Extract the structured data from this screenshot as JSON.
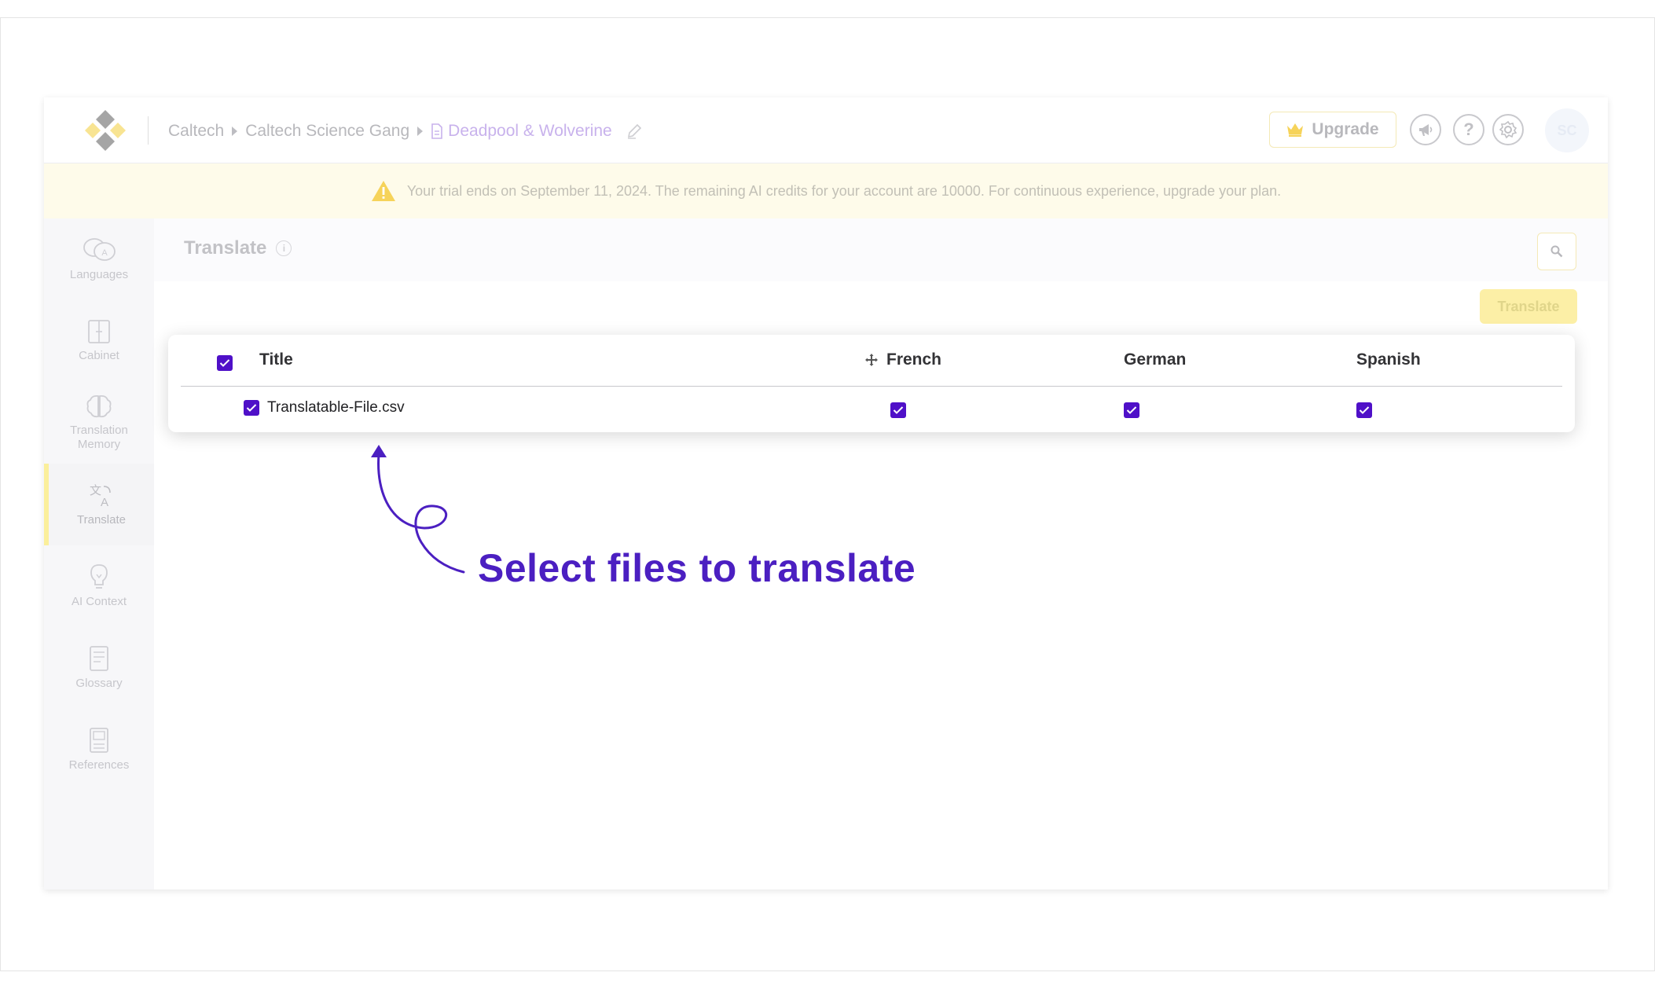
{
  "breadcrumb": {
    "org": "Caltech",
    "team": "Caltech Science Gang",
    "project": "Deadpool & Wolverine"
  },
  "header": {
    "upgrade_label": "Upgrade",
    "help_glyph": "?",
    "avatar_initials": "SC"
  },
  "banner": {
    "text": "Your trial ends on September 11, 2024. The remaining AI credits for your account are 10000. For continuous experience, upgrade your plan."
  },
  "sidebar": {
    "items": [
      {
        "label": "Languages",
        "icon": "languages-icon"
      },
      {
        "label": "Cabinet",
        "icon": "cabinet-icon"
      },
      {
        "label": "Translation Memory",
        "icon": "brain-icon"
      },
      {
        "label": "Translate",
        "icon": "translate-icon",
        "active": true
      },
      {
        "label": "AI Context",
        "icon": "lightbulb-icon"
      },
      {
        "label": "Glossary",
        "icon": "glossary-icon"
      },
      {
        "label": "References",
        "icon": "references-icon"
      }
    ]
  },
  "main": {
    "title": "Translate",
    "info_glyph": "i",
    "translate_button": "Translate"
  },
  "table": {
    "columns": [
      "Title",
      "French",
      "German",
      "Spanish"
    ],
    "rows": [
      {
        "title": "Translatable-File.csv",
        "checked": true,
        "french": true,
        "german": true,
        "spanish": true
      }
    ],
    "header_checked": true
  },
  "annotation": {
    "text": "Select files to translate",
    "color": "#4b1fc1"
  },
  "colors": {
    "checkbox": "#4f10c8",
    "accent_yellow": "#fcefa6",
    "project_link": "#c8b2ec"
  }
}
